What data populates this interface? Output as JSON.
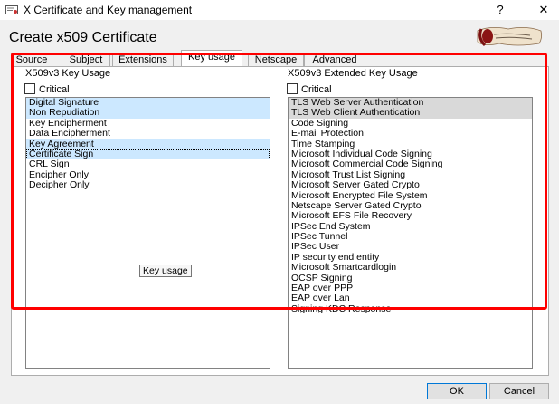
{
  "window": {
    "title": "X Certificate and Key management",
    "help_label": "?",
    "close_label": "✕"
  },
  "header": {
    "page_title": "Create x509 Certificate"
  },
  "tabs": [
    {
      "label": "Source"
    },
    {
      "label": "Subject"
    },
    {
      "label": "Extensions"
    },
    {
      "label": "Key usage",
      "active": true
    },
    {
      "label": "Netscape"
    },
    {
      "label": "Advanced"
    }
  ],
  "key_usage": {
    "group_label": "X509v3 Key Usage",
    "critical_label": "Critical",
    "items": [
      {
        "label": "Digital Signature",
        "state": "selected"
      },
      {
        "label": "Non Repudiation",
        "state": "selected"
      },
      {
        "label": "Key Encipherment",
        "state": "normal"
      },
      {
        "label": "Data Encipherment",
        "state": "normal"
      },
      {
        "label": "Key Agreement",
        "state": "selected"
      },
      {
        "label": "Certificate Sign",
        "state": "focused"
      },
      {
        "label": "CRL Sign",
        "state": "normal"
      },
      {
        "label": "Encipher Only",
        "state": "normal"
      },
      {
        "label": "Decipher Only",
        "state": "normal"
      }
    ]
  },
  "ext_key_usage": {
    "group_label": "X509v3 Extended Key Usage",
    "critical_label": "Critical",
    "items": [
      {
        "label": "TLS Web Server Authentication",
        "state": "selected-gray"
      },
      {
        "label": "TLS Web Client Authentication",
        "state": "selected-gray"
      },
      {
        "label": "Code Signing",
        "state": "normal"
      },
      {
        "label": "E-mail Protection",
        "state": "normal"
      },
      {
        "label": "Time Stamping",
        "state": "normal"
      },
      {
        "label": "Microsoft Individual Code Signing",
        "state": "normal"
      },
      {
        "label": "Microsoft Commercial Code Signing",
        "state": "normal"
      },
      {
        "label": "Microsoft Trust List Signing",
        "state": "normal"
      },
      {
        "label": "Microsoft Server Gated Crypto",
        "state": "normal"
      },
      {
        "label": "Microsoft Encrypted File System",
        "state": "normal"
      },
      {
        "label": "Netscape Server Gated Crypto",
        "state": "normal"
      },
      {
        "label": "Microsoft EFS File Recovery",
        "state": "normal"
      },
      {
        "label": "IPSec End System",
        "state": "normal"
      },
      {
        "label": "IPSec Tunnel",
        "state": "normal"
      },
      {
        "label": "IPSec User",
        "state": "normal"
      },
      {
        "label": "IP security end entity",
        "state": "normal"
      },
      {
        "label": "Microsoft Smartcardlogin",
        "state": "normal"
      },
      {
        "label": "OCSP Signing",
        "state": "normal"
      },
      {
        "label": "EAP over PPP",
        "state": "normal"
      },
      {
        "label": "EAP over Lan",
        "state": "normal"
      },
      {
        "label": "Signing KDC Response",
        "state": "normal"
      }
    ]
  },
  "tooltip": "Key usage",
  "buttons": {
    "ok": "OK",
    "cancel": "Cancel"
  },
  "colors": {
    "highlight": "#ff0000",
    "selection": "#cce8ff",
    "selection_inactive": "#d9d9d9"
  }
}
